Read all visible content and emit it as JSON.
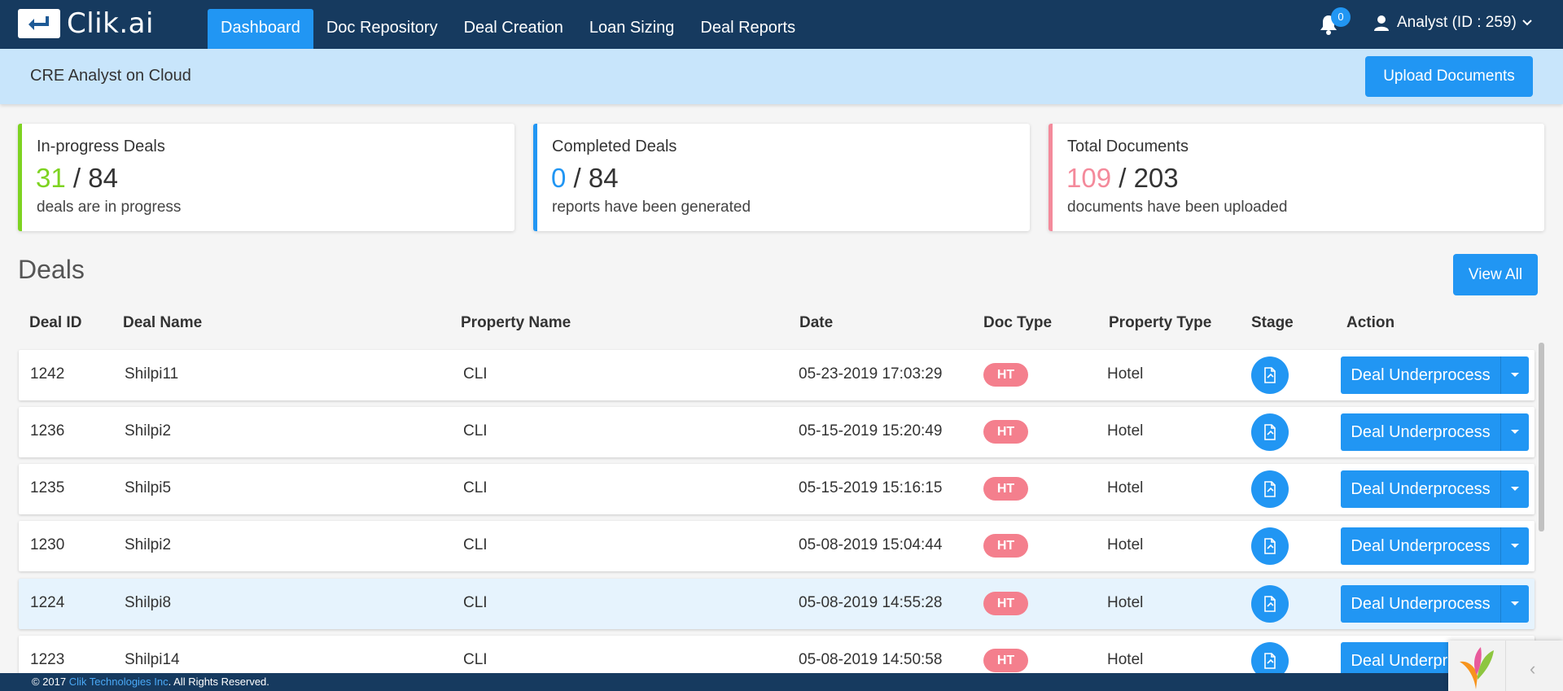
{
  "app": {
    "logo_text": "Clik.ai"
  },
  "nav": {
    "items": [
      {
        "label": "Dashboard",
        "active": true
      },
      {
        "label": "Doc Repository",
        "active": false
      },
      {
        "label": "Deal Creation",
        "active": false
      },
      {
        "label": "Loan Sizing",
        "active": false
      },
      {
        "label": "Deal Reports",
        "active": false
      }
    ],
    "notification_count": "0",
    "user_label": "Analyst (ID : 259)"
  },
  "subheader": {
    "title": "CRE Analyst on Cloud",
    "upload_label": "Upload Documents"
  },
  "cards": [
    {
      "title": "In-progress Deals",
      "value": "31",
      "sep": " / ",
      "total": "84",
      "desc": "deals are in progress",
      "accent": "#7ed321"
    },
    {
      "title": "Completed Deals",
      "value": "0",
      "sep": " / ",
      "total": "84",
      "desc": "reports have been generated",
      "accent": "#2196f3"
    },
    {
      "title": "Total Documents",
      "value": "109",
      "sep": " / ",
      "total": "203",
      "desc": "documents have been uploaded",
      "accent": "#f48a9b"
    }
  ],
  "deals": {
    "title": "Deals",
    "view_all_label": "View All",
    "columns": [
      "Deal ID",
      "Deal Name",
      "Property Name",
      "Date",
      "Doc Type",
      "Property Type",
      "Stage",
      "Action"
    ],
    "rows": [
      {
        "id": "1242",
        "name": "Shilpi11",
        "property": "CLI",
        "date": "05-23-2019 17:03:29",
        "doc_type": "HT",
        "property_type": "Hotel",
        "action": "Deal Underprocess"
      },
      {
        "id": "1236",
        "name": "Shilpi2",
        "property": "CLI",
        "date": "05-15-2019 15:20:49",
        "doc_type": "HT",
        "property_type": "Hotel",
        "action": "Deal Underprocess"
      },
      {
        "id": "1235",
        "name": "Shilpi5",
        "property": "CLI",
        "date": "05-15-2019 15:16:15",
        "doc_type": "HT",
        "property_type": "Hotel",
        "action": "Deal Underprocess"
      },
      {
        "id": "1230",
        "name": "Shilpi2",
        "property": "CLI",
        "date": "05-08-2019 15:04:44",
        "doc_type": "HT",
        "property_type": "Hotel",
        "action": "Deal Underprocess"
      },
      {
        "id": "1224",
        "name": "Shilpi8",
        "property": "CLI",
        "date": "05-08-2019 14:55:28",
        "doc_type": "HT",
        "property_type": "Hotel",
        "action": "Deal Underprocess"
      },
      {
        "id": "1223",
        "name": "Shilpi14",
        "property": "CLI",
        "date": "05-08-2019 14:50:58",
        "doc_type": "HT",
        "property_type": "Hotel",
        "action": "Deal Underprocess"
      }
    ]
  },
  "footer": {
    "prefix": "© 2017 ",
    "link": "Clik Technologies Inc",
    "suffix": ". All Rights Reserved."
  },
  "colors": {
    "nav_bg": "#163a5f",
    "primary": "#2196f3",
    "subheader_bg": "#c8e5fb",
    "badge_ht": "#f47f8d"
  }
}
